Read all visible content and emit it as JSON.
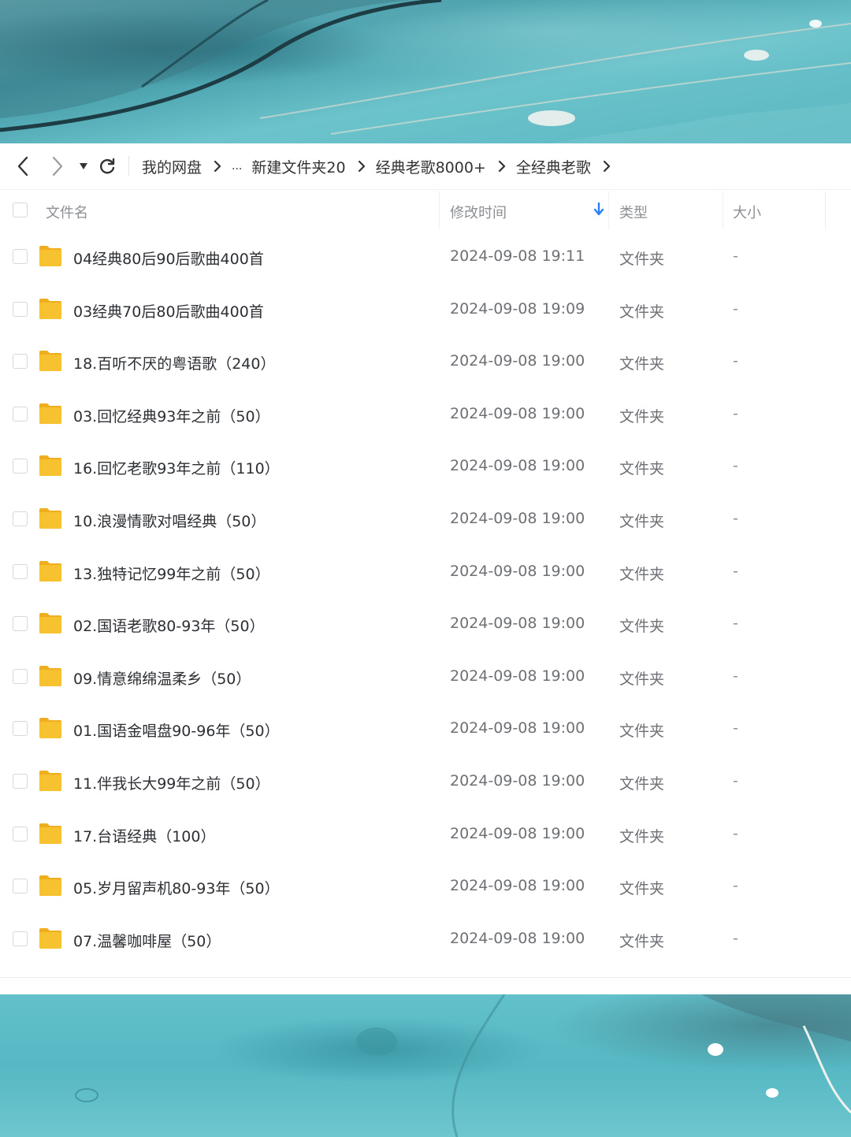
{
  "toolbar": {
    "back_icon": "chevron-left-icon",
    "forward_icon": "chevron-right-icon",
    "history_icon": "caret-down-icon",
    "refresh_icon": "refresh-icon"
  },
  "breadcrumb": {
    "items": [
      "我的网盘",
      "...",
      "新建文件夹20",
      "经典老歌8000+",
      "全经典老歌"
    ]
  },
  "table": {
    "headers": {
      "name": "文件名",
      "modified": "修改时间",
      "type": "类型",
      "size": "大小"
    },
    "sort_icon": "arrow-down-icon",
    "rows": [
      {
        "name": "04经典80后90后歌曲400首",
        "modified": "2024-09-08 19:11",
        "type": "文件夹",
        "size": "-"
      },
      {
        "name": "03经典70后80后歌曲400首",
        "modified": "2024-09-08 19:09",
        "type": "文件夹",
        "size": "-"
      },
      {
        "name": "18.百听不厌的粤语歌（240）",
        "modified": "2024-09-08 19:00",
        "type": "文件夹",
        "size": "-"
      },
      {
        "name": "03.回忆经典93年之前（50）",
        "modified": "2024-09-08 19:00",
        "type": "文件夹",
        "size": "-"
      },
      {
        "name": "16.回忆老歌93年之前（110）",
        "modified": "2024-09-08 19:00",
        "type": "文件夹",
        "size": "-"
      },
      {
        "name": "10.浪漫情歌对唱经典（50）",
        "modified": "2024-09-08 19:00",
        "type": "文件夹",
        "size": "-"
      },
      {
        "name": "13.独特记忆99年之前（50）",
        "modified": "2024-09-08 19:00",
        "type": "文件夹",
        "size": "-"
      },
      {
        "name": "02.国语老歌80-93年（50）",
        "modified": "2024-09-08 19:00",
        "type": "文件夹",
        "size": "-"
      },
      {
        "name": "09.情意绵绵温柔乡（50）",
        "modified": "2024-09-08 19:00",
        "type": "文件夹",
        "size": "-"
      },
      {
        "name": "01.国语金唱盘90-96年（50）",
        "modified": "2024-09-08 19:00",
        "type": "文件夹",
        "size": "-"
      },
      {
        "name": "11.伴我长大99年之前（50）",
        "modified": "2024-09-08 19:00",
        "type": "文件夹",
        "size": "-"
      },
      {
        "name": "17.台语经典（100）",
        "modified": "2024-09-08 19:00",
        "type": "文件夹",
        "size": "-"
      },
      {
        "name": "05.岁月留声机80-93年（50）",
        "modified": "2024-09-08 19:00",
        "type": "文件夹",
        "size": "-"
      },
      {
        "name": "07.温馨咖啡屋（50）",
        "modified": "2024-09-08 19:00",
        "type": "文件夹",
        "size": "-"
      }
    ]
  },
  "colors": {
    "folder": "#f7c230",
    "folder_dark": "#eeae1d",
    "sort_arrow": "#2a7fff",
    "banner_teal": "#5bbac4"
  }
}
